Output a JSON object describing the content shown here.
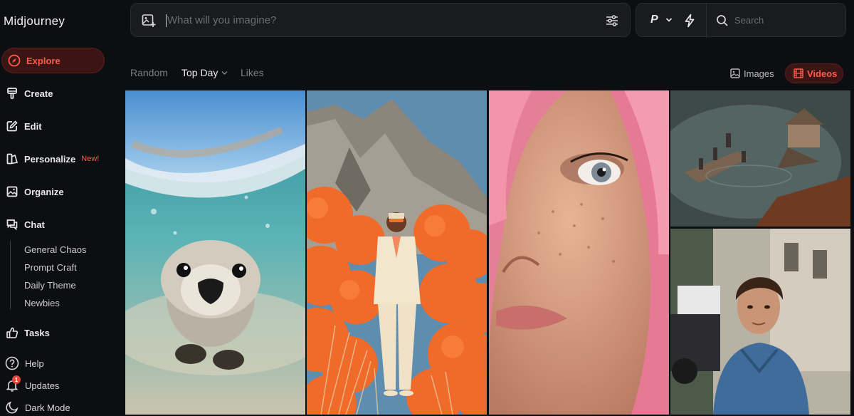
{
  "app": {
    "brand": "Midjourney"
  },
  "sidebar": {
    "items": [
      {
        "label": "Explore",
        "icon": "compass-icon",
        "active": true
      },
      {
        "label": "Create",
        "icon": "brush-icon"
      },
      {
        "label": "Edit",
        "icon": "edit-icon"
      },
      {
        "label": "Personalize",
        "icon": "personalize-icon",
        "badge": "New!"
      },
      {
        "label": "Organize",
        "icon": "image-icon"
      },
      {
        "label": "Chat",
        "icon": "chat-icon"
      }
    ],
    "chat_rooms": [
      "General Chaos",
      "Prompt Craft",
      "Daily Theme",
      "Newbies"
    ],
    "tasks": {
      "label": "Tasks",
      "icon": "thumbs-up-icon"
    },
    "bottom": [
      {
        "label": "Help",
        "icon": "help-icon"
      },
      {
        "label": "Updates",
        "icon": "bell-icon",
        "count": "1"
      },
      {
        "label": "Dark Mode",
        "icon": "moon-icon"
      }
    ]
  },
  "prompt": {
    "placeholder": "What will you imagine?"
  },
  "mode": {
    "label": "P"
  },
  "search": {
    "placeholder": "Search"
  },
  "filters": {
    "random": "Random",
    "top_day": "Top Day",
    "likes": "Likes"
  },
  "views": {
    "images": "Images",
    "videos": "Videos"
  },
  "colors": {
    "accent": "#ff5a4a",
    "accent_bg": "#3a1514",
    "panel": "#1a1b1f",
    "background": "#0d0e11"
  },
  "gallery": [
    {
      "subject": "otter-underwater"
    },
    {
      "subject": "man-white-suit-orange-spheres"
    },
    {
      "subject": "freckled-face-pink-hair"
    },
    {
      "subject": "miniature-boat-diorama"
    },
    {
      "subject": "woman-denim-jacket-street"
    }
  ]
}
